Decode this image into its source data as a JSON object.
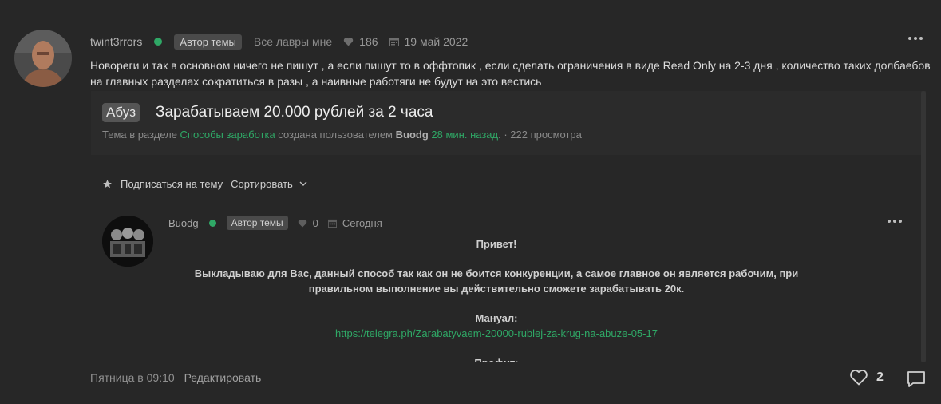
{
  "post": {
    "username": "twint3rrors",
    "badge": "Автор темы",
    "status": "Все лавры мне",
    "likes": "186",
    "date": "19 май 2022",
    "text": "Новореги и так в основном ничего не пишут , а если пишут то в оффтопик , если сделать ограничения в виде Read Only на 2-3 дня , количество таких долбаебов на главных разделах сократиться в разы , а наивные работяги не будут на это вестись",
    "footer_time": "Пятница в 09:10",
    "edit_label": "Редактировать",
    "reaction_count": "2"
  },
  "embed": {
    "prefix": "Абуз",
    "title": "Зарабатываем 20.000 рублей за 2 часа",
    "sub_before": "Тема в разделе ",
    "section": "Способы заработка",
    "sub_mid": " создана пользователем ",
    "author": "Buodg",
    "time_ago": "28 мин. назад",
    "sub_after": ". · 222 просмотра",
    "subscribe_label": "Подписаться на тему",
    "sort_label": "Сортировать",
    "inner_post": {
      "username": "Buodg",
      "badge": "Автор темы",
      "likes": "0",
      "date": "Сегодня",
      "greeting": "Привет!",
      "paragraph": "Выкладываю для Вас, данный способ так как он не боится конкуренции, а самое главное он является рабочим, при правильном выполнение вы действительно сможете зарабатывать 20к.",
      "manual_label": "Мануал:",
      "manual_link": "https://telegra.ph/Zarabatyvaem-20000-rublej-za-krug-na-abuze-05-17",
      "profit_label": "Профит:"
    }
  },
  "colors": {
    "background": "#272727",
    "accent_green": "#2fa866",
    "badge_bg": "#4a4a4a"
  }
}
